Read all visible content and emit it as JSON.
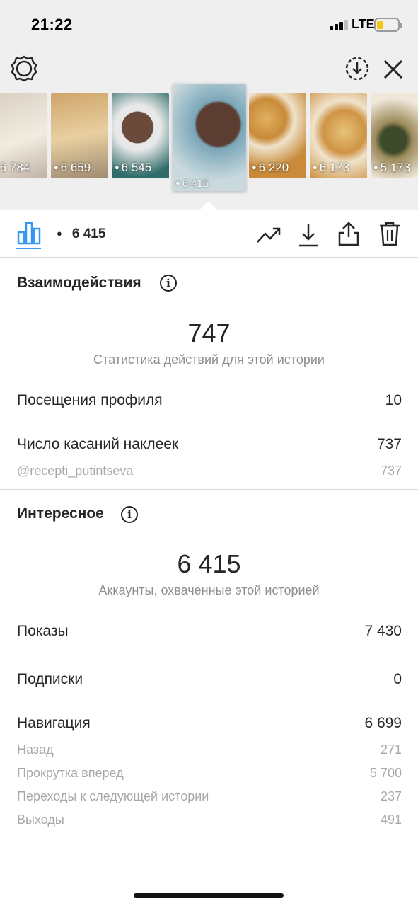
{
  "status_bar": {
    "time": "21:22",
    "network": "LTE"
  },
  "colors": {
    "accent": "#3897f0",
    "primary_text": "#262626",
    "secondary_text": "#8e8e8e",
    "battery": "#f5c518"
  },
  "header": {
    "left_icon": "settings-gear-icon",
    "right_icons": [
      "download-circle-icon",
      "close-icon"
    ]
  },
  "story_thumbnails": [
    {
      "views": "6 784",
      "selected": false,
      "colors": [
        "#d8cfc2",
        "#f2ece0"
      ]
    },
    {
      "views": "6 659",
      "selected": false,
      "colors": [
        "#cfa56b",
        "#9e8a72"
      ]
    },
    {
      "views": "6 545",
      "selected": false,
      "colors": [
        "#6a4a3a",
        "#2e6d6a"
      ]
    },
    {
      "views": "6 415",
      "selected": true,
      "colors": [
        "#5b3d32",
        "#7aa7b8"
      ]
    },
    {
      "views": "6 220",
      "selected": false,
      "colors": [
        "#c98b3a",
        "#e0b060"
      ]
    },
    {
      "views": "6 173",
      "selected": false,
      "colors": [
        "#cf9445",
        "#e7c27a"
      ]
    },
    {
      "views": "5 173",
      "selected": false,
      "colors": [
        "#3d4a2c",
        "#9c8a5a"
      ]
    }
  ],
  "toolbar": {
    "views": "6 415",
    "icons": [
      "bar-chart-icon",
      "eye-icon",
      "trending-up-icon",
      "download-icon",
      "share-icon",
      "trash-icon"
    ]
  },
  "interactions": {
    "title": "Взаимодействия",
    "total": "747",
    "caption": "Статистика действий для этой истории",
    "rows": [
      {
        "label": "Посещения профиля",
        "value": "10",
        "kind": "main"
      },
      {
        "label": "Число касаний наклеек",
        "value": "737",
        "kind": "main"
      },
      {
        "label": "@recepti_putintseva",
        "value": "737",
        "kind": "sub"
      }
    ]
  },
  "discovery": {
    "title": "Интересное",
    "total": "6 415",
    "caption": "Аккаунты, охваченные этой историей",
    "rows": [
      {
        "label": "Показы",
        "value": "7 430",
        "kind": "main"
      },
      {
        "label": "Подписки",
        "value": "0",
        "kind": "main"
      },
      {
        "label": "Навигация",
        "value": "6 699",
        "kind": "main"
      },
      {
        "label": "Назад",
        "value": "271",
        "kind": "sub"
      },
      {
        "label": "Прокрутка вперед",
        "value": "5 700",
        "kind": "sub"
      },
      {
        "label": "Переходы к следующей истории",
        "value": "237",
        "kind": "sub"
      },
      {
        "label": "Выходы",
        "value": "491",
        "kind": "sub"
      }
    ]
  }
}
